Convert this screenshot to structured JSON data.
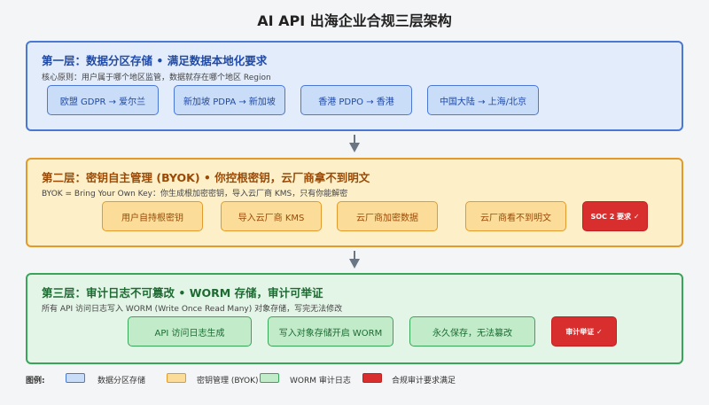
{
  "title": "AI API 出海企业合规三层架构",
  "layers": [
    {
      "title": "第一层：数据分区存储 • 满足数据本地化要求",
      "description": "核心原则：用户属于哪个地区监管，数据就存在哪个地区 Region",
      "boxes": [
        "欧盟 GDPR → 爱尔兰",
        "新加坡 PDPA → 新加坡",
        "香港 PDPO → 香港",
        "中国大陆 → 上海/北京"
      ]
    },
    {
      "title": "第二层：密钥自主管理 (BYOK) • 你控根密钥，云厂商拿不到明文",
      "description": "BYOK = Bring Your Own Key：你生成根加密密钥，导入云厂商 KMS，只有你能解密",
      "boxes": [
        "用户自持根密钥",
        "导入云厂商 KMS",
        "云厂商加密数据",
        "云厂商看不到明文"
      ],
      "requirement": "SOC 2 要求 ✓"
    },
    {
      "title": "第三层：审计日志不可篡改 • WORM 存储，审计可举证",
      "description": "所有 API 访问日志写入 WORM (Write Once Read Many) 对象存储，写完无法修改",
      "boxes": [
        "API 访问日志生成",
        "写入对象存储开启 WORM",
        "永久保存，无法篡改"
      ],
      "requirement": "审计举证 ✓"
    }
  ],
  "legend": {
    "title": "图例:",
    "items": [
      {
        "label": "数据分区存储",
        "fill": "#c9dcf8",
        "stroke": "#4a78d4"
      },
      {
        "label": "密钥管理 (BYOK)",
        "fill": "#fbdd99",
        "stroke": "#e39a2c"
      },
      {
        "label": "WORM 审计日志",
        "fill": "#c2ebc9",
        "stroke": "#3aa55a"
      },
      {
        "label": "合规审计要求满足",
        "fill": "#d82e2e",
        "stroke": "#c02020"
      }
    ]
  },
  "colors": {
    "arrow": "#6b7684"
  }
}
